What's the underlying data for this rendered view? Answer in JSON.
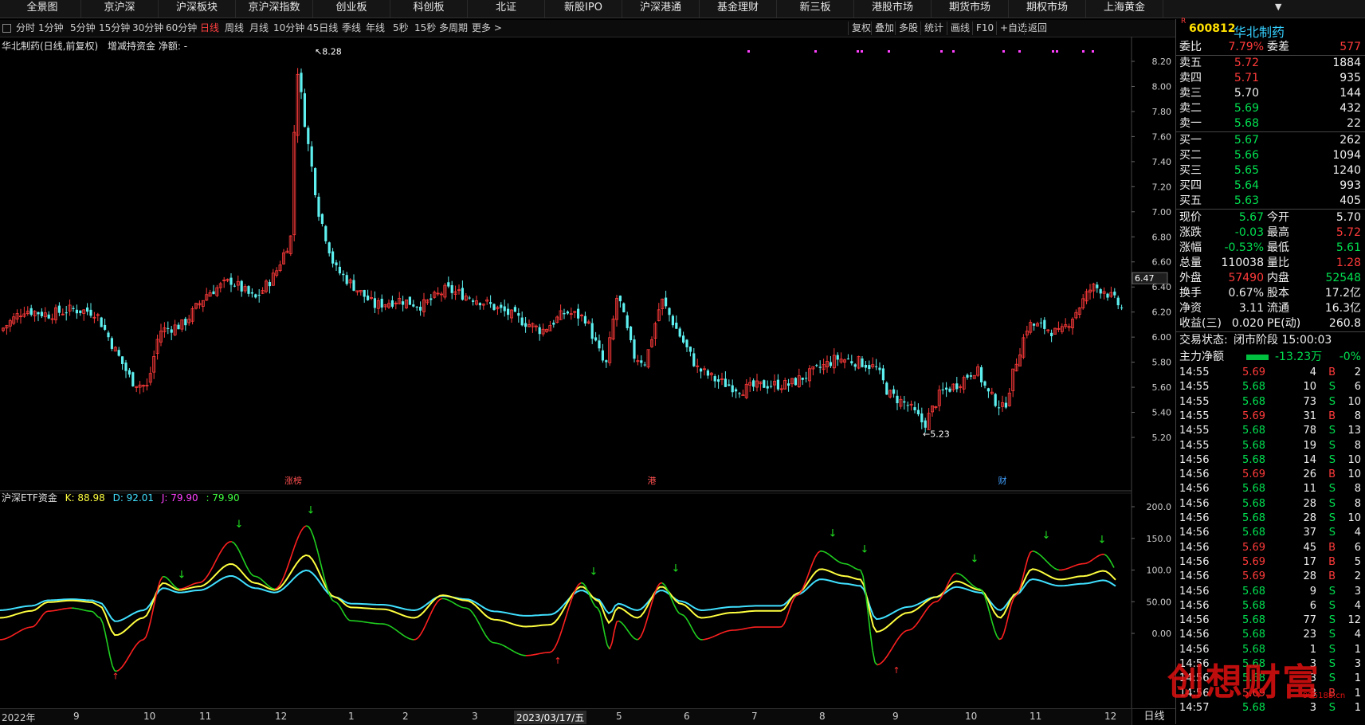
{
  "topnav": [
    "全景图",
    "京沪深",
    "沪深板块",
    "京沪深指数",
    "创业板",
    "科创板",
    "北证",
    "新股IPO",
    "沪深港通",
    "基金理财",
    "新三板",
    "港股市场",
    "期货市场",
    "期权市场",
    "上海黄金"
  ],
  "periods": [
    "分时",
    "1分钟",
    "5分钟",
    "15分钟",
    "30分钟",
    "60分钟",
    "日线",
    "周线",
    "月线",
    "10分钟",
    "45日线",
    "季线",
    "年线",
    "5秒",
    "15秒",
    "多周期",
    "更多 >"
  ],
  "active_period": "日线",
  "tools": [
    "复权",
    "叠加",
    "多股",
    "统计",
    "画线",
    "F10",
    "+自选",
    "返回"
  ],
  "chart_title": "华北制药(日线,前复权)",
  "chart_sub": "增减持资金  净额: -",
  "indicator": {
    "name": "沪深ETF资金",
    "K": "K: 88.98",
    "D": "D: 92.01",
    "J": "J: 79.90",
    "V": ": 79.90"
  },
  "price_axis": [
    "8.20",
    "8.00",
    "7.80",
    "7.60",
    "7.40",
    "7.20",
    "7.00",
    "6.80",
    "6.60",
    "6.40",
    "6.20",
    "6.00",
    "5.80",
    "5.60",
    "5.40",
    "5.20"
  ],
  "ind_axis": [
    "200.0",
    "150.0",
    "100.0",
    "50.00",
    "0.00"
  ],
  "cursor_price": "6.47",
  "annotations": {
    "high": "8.28",
    "low": "5.23",
    "tag1": "涨榜",
    "tag2": "港",
    "tag3": "财"
  },
  "date_axis": [
    "2022年",
    "9",
    "10",
    "11",
    "12",
    "1",
    "2",
    "3",
    "2023/03/17/五",
    "5",
    "6",
    "7",
    "8",
    "9",
    "10",
    "11",
    "12"
  ],
  "period_label": "日线",
  "stock": {
    "code": "600812",
    "name": "华北制药",
    "badge": "R"
  },
  "weibi": {
    "l1": "委比",
    "v1": "7.79%",
    "l2": "委差",
    "v2": "577"
  },
  "sells": [
    {
      "label": "卖五",
      "price": "5.72",
      "vol": "1884"
    },
    {
      "label": "卖四",
      "price": "5.71",
      "vol": "935"
    },
    {
      "label": "卖三",
      "price": "5.70",
      "vol": "144"
    },
    {
      "label": "卖二",
      "price": "5.69",
      "vol": "432"
    },
    {
      "label": "卖一",
      "price": "5.68",
      "vol": "22"
    }
  ],
  "buys": [
    {
      "label": "买一",
      "price": "5.67",
      "vol": "262"
    },
    {
      "label": "买二",
      "price": "5.66",
      "vol": "1094"
    },
    {
      "label": "买三",
      "price": "5.65",
      "vol": "1240"
    },
    {
      "label": "买四",
      "price": "5.64",
      "vol": "993"
    },
    {
      "label": "买五",
      "price": "5.63",
      "vol": "405"
    }
  ],
  "quote": [
    {
      "l1": "现价",
      "v1": "5.67",
      "l2": "今开",
      "v2": "5.70"
    },
    {
      "l1": "涨跌",
      "v1": "-0.03",
      "l2": "最高",
      "v2": "5.72"
    },
    {
      "l1": "涨幅",
      "v1": "-0.53%",
      "l2": "最低",
      "v2": "5.61"
    },
    {
      "l1": "总量",
      "v1": "110038",
      "l2": "量比",
      "v2": "1.28"
    },
    {
      "l1": "外盘",
      "v1": "57490",
      "l2": "内盘",
      "v2": "52548"
    },
    {
      "l1": "换手",
      "v1": "0.67%",
      "l2": "股本",
      "v2": "17.2亿"
    },
    {
      "l1": "净资",
      "v1": "3.11",
      "l2": "流通",
      "v2": "16.3亿"
    },
    {
      "l1": "收益(三)",
      "v1": "0.020",
      "l2": "PE(动)",
      "v2": "260.8"
    }
  ],
  "trade_status": {
    "label": "交易状态:",
    "value": "闭市阶段 15:00:03"
  },
  "main_flow": {
    "label": "主力净额",
    "value": "-13.23万",
    "pct": "-0%"
  },
  "ticks": [
    {
      "t": "14:55",
      "p": "5.69",
      "v": "4",
      "s": "B",
      "n": "2"
    },
    {
      "t": "14:55",
      "p": "5.68",
      "v": "10",
      "s": "S",
      "n": "6"
    },
    {
      "t": "14:55",
      "p": "5.68",
      "v": "73",
      "s": "S",
      "n": "10"
    },
    {
      "t": "14:55",
      "p": "5.69",
      "v": "31",
      "s": "B",
      "n": "8"
    },
    {
      "t": "14:55",
      "p": "5.68",
      "v": "78",
      "s": "S",
      "n": "13"
    },
    {
      "t": "14:55",
      "p": "5.68",
      "v": "19",
      "s": "S",
      "n": "8"
    },
    {
      "t": "14:56",
      "p": "5.68",
      "v": "14",
      "s": "S",
      "n": "10"
    },
    {
      "t": "14:56",
      "p": "5.69",
      "v": "26",
      "s": "B",
      "n": "10"
    },
    {
      "t": "14:56",
      "p": "5.68",
      "v": "11",
      "s": "S",
      "n": "8"
    },
    {
      "t": "14:56",
      "p": "5.68",
      "v": "28",
      "s": "S",
      "n": "8"
    },
    {
      "t": "14:56",
      "p": "5.68",
      "v": "28",
      "s": "S",
      "n": "10"
    },
    {
      "t": "14:56",
      "p": "5.68",
      "v": "37",
      "s": "S",
      "n": "4"
    },
    {
      "t": "14:56",
      "p": "5.69",
      "v": "45",
      "s": "B",
      "n": "6"
    },
    {
      "t": "14:56",
      "p": "5.69",
      "v": "17",
      "s": "B",
      "n": "5"
    },
    {
      "t": "14:56",
      "p": "5.69",
      "v": "28",
      "s": "B",
      "n": "2"
    },
    {
      "t": "14:56",
      "p": "5.68",
      "v": "9",
      "s": "S",
      "n": "3"
    },
    {
      "t": "14:56",
      "p": "5.68",
      "v": "6",
      "s": "S",
      "n": "4"
    },
    {
      "t": "14:56",
      "p": "5.68",
      "v": "77",
      "s": "S",
      "n": "12"
    },
    {
      "t": "14:56",
      "p": "5.68",
      "v": "23",
      "s": "S",
      "n": "4"
    },
    {
      "t": "14:56",
      "p": "5.68",
      "v": "1",
      "s": "S",
      "n": "1"
    },
    {
      "t": "14:56",
      "p": "5.68",
      "v": "3",
      "s": "S",
      "n": "3"
    },
    {
      "t": "14:56",
      "p": "5.68",
      "v": "3",
      "s": "S",
      "n": "1"
    },
    {
      "t": "14:56",
      "p": "5.69",
      "v": "3",
      "s": "B",
      "n": "1"
    },
    {
      "t": "14:57",
      "p": "5.68",
      "v": "3",
      "s": "S",
      "n": "1"
    }
  ],
  "watermark": {
    "text": "创想财富",
    "url": "995188.cn"
  },
  "colors": {
    "up": "#ff3a3a",
    "down": "#5ef0f0",
    "k": "#ffff40",
    "d": "#40e0ff",
    "j": "#ff40ff"
  }
}
